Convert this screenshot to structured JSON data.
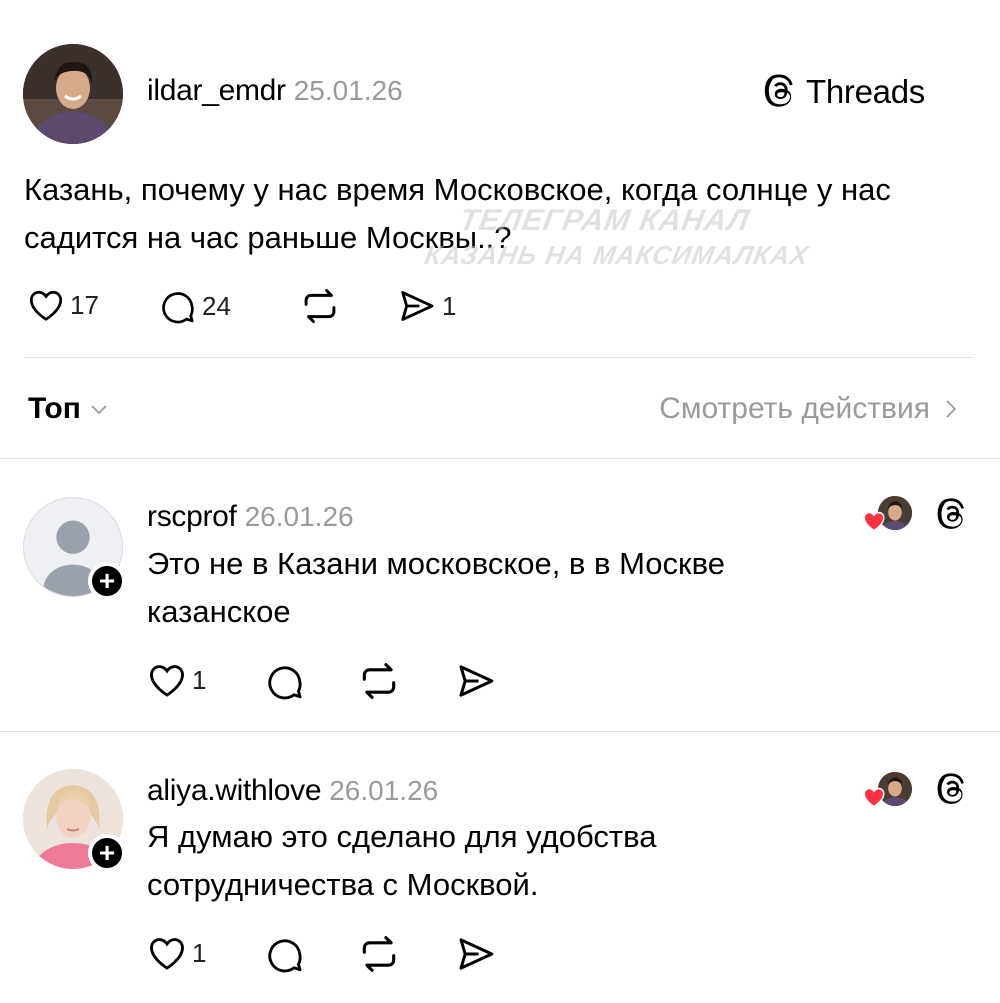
{
  "post": {
    "username": "ildar_emdr",
    "date": "25.01.26",
    "brand": "Threads",
    "text": "Казань, почему у нас время Московское, когда солнце у нас садится на час раньше Москвы..?",
    "likes": "17",
    "replies": "24",
    "shares": "1"
  },
  "watermark": {
    "line1": "ТЕЛЕГРАМ КАНАЛ",
    "line2": "КАЗАНЬ НА МАКСИМАЛКАХ"
  },
  "sort": {
    "label": "Топ",
    "activity_link": "Смотреть действия"
  },
  "comments": [
    {
      "username": "rscprof",
      "date": "26.01.26",
      "text": "Это не в Казани московское, в в Москве казанское",
      "likes": "1"
    },
    {
      "username": "aliya.withlove",
      "date": "26.01.26",
      "text": "Я думаю это сделано для удобства сотрудничества с Москвой.",
      "likes": "1"
    }
  ],
  "colors": {
    "accent_heart": "#ff3040",
    "muted": "#9a9a9a",
    "divider": "#e3e3e3"
  }
}
